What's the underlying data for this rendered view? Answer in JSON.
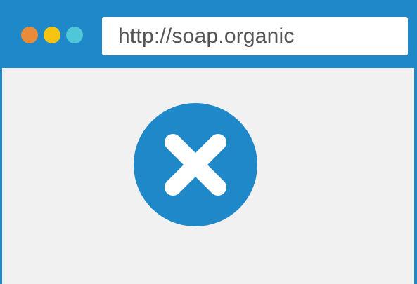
{
  "browser": {
    "address_bar": {
      "url": "http://soap.organic"
    },
    "window_controls": [
      {
        "name": "close",
        "color": "#ea8b3a"
      },
      {
        "name": "minimize",
        "color": "#f7c411"
      },
      {
        "name": "maximize",
        "color": "#4fc7d9"
      }
    ]
  },
  "content": {
    "status_icon": "error-x-icon"
  },
  "colors": {
    "accent": "#1e88c8",
    "page_background": "#f1f1f1",
    "icon_glyph": "#ffffff"
  }
}
